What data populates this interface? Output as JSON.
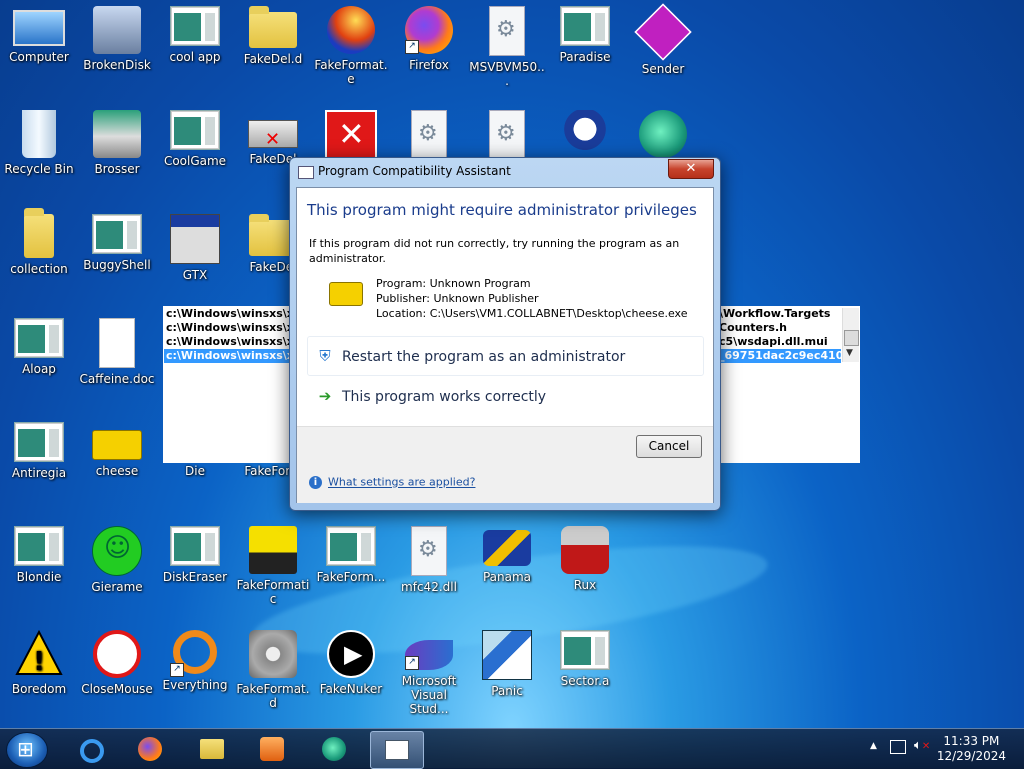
{
  "desktop": {
    "icons": [
      {
        "label": "Computer",
        "icon": "computer-icon"
      },
      {
        "label": "BrokenDisk",
        "icon": "brokendisk-icon"
      },
      {
        "label": "cool app",
        "icon": "window-icon"
      },
      {
        "label": "FakeDel.d",
        "icon": "folder-icon"
      },
      {
        "label": "FakeFormat.e",
        "icon": "torch-icon"
      },
      {
        "label": "Firefox",
        "icon": "firefox-icon"
      },
      {
        "label": "MSVBVM50...",
        "icon": "gear-doc-icon"
      },
      {
        "label": "Paradise",
        "icon": "window-icon"
      },
      {
        "label": "Sender",
        "icon": "sender-icon"
      },
      {
        "label": "Recycle Bin",
        "icon": "recycle-bin-icon"
      },
      {
        "label": "Brosser",
        "icon": "brosser-icon"
      },
      {
        "label": "CoolGame",
        "icon": "window-icon"
      },
      {
        "label": "FakeDel",
        "icon": "fakedel-icon"
      },
      {
        "label": "collection",
        "icon": "folder-icon"
      },
      {
        "label": "BuggyShell",
        "icon": "window-icon"
      },
      {
        "label": "GTX",
        "icon": "gtx-icon"
      },
      {
        "label": "FakeDel",
        "icon": "folder-icon"
      },
      {
        "label": "Aloap",
        "icon": "window-icon"
      },
      {
        "label": "Caffeine.doc",
        "icon": "document-icon"
      },
      {
        "label": "Antiregia",
        "icon": "window-icon"
      },
      {
        "label": "cheese",
        "icon": "cheese-icon"
      },
      {
        "label": "Die",
        "icon": "window-icon"
      },
      {
        "label": "FakeForm",
        "icon": "window-icon"
      },
      {
        "label": "Blondie",
        "icon": "window-icon"
      },
      {
        "label": "Gierame",
        "icon": "smiley-icon"
      },
      {
        "label": "DiskEraser",
        "icon": "window-icon"
      },
      {
        "label": "FakeFormatic",
        "icon": "fakeformatic-icon"
      },
      {
        "label": "FakeForm...",
        "icon": "window-icon"
      },
      {
        "label": "mfc42.dll",
        "icon": "gear-doc-icon"
      },
      {
        "label": "Panama",
        "icon": "handshake-icon"
      },
      {
        "label": "Rux",
        "icon": "rux-icon"
      },
      {
        "label": "Boredom",
        "icon": "warning-icon"
      },
      {
        "label": "CloseMouse",
        "icon": "no-arp-icon"
      },
      {
        "label": "Everything",
        "icon": "everything-icon"
      },
      {
        "label": "FakeFormat.d",
        "icon": "disk-icon"
      },
      {
        "label": "FakeNuker",
        "icon": "play-icon"
      },
      {
        "label": "Microsoft Visual Stud...",
        "icon": "visual-studio-icon"
      },
      {
        "label": "Panic",
        "icon": "panic-icon"
      },
      {
        "label": "Sector.a",
        "icon": "window-icon"
      }
    ]
  },
  "background_list": {
    "left_rows": [
      "c:\\Windows\\winsxs\\x8",
      "c:\\Windows\\winsxs\\x8",
      "c:\\Windows\\winsxs\\x8",
      "c:\\Windows\\winsxs\\x8"
    ],
    "right_rows": [
      "\\Workflow.Targets",
      "Counters.h",
      "c5\\wsdapi.dll.mui",
      "_69751dac2c9ec410\\Xa"
    ]
  },
  "dialog": {
    "title": "Program Compatibility Assistant",
    "close_label": "✕",
    "heading": "This program might require administrator privileges",
    "description": "If this program did not run correctly, try running the program as an administrator.",
    "program": "Program: Unknown Program",
    "publisher": "Publisher: Unknown Publisher",
    "location": "Location: C:\\Users\\VM1.COLLABNET\\Desktop\\cheese.exe",
    "option_restart": "Restart the program as an administrator",
    "option_works": "This program works correctly",
    "cancel_label": "Cancel",
    "help_link": "What settings are applied?"
  },
  "taskbar": {
    "pinned": [
      "internet-explorer-icon",
      "firefox-icon",
      "file-explorer-icon",
      "media-player-icon",
      "app-icon",
      "active-window-icon"
    ],
    "time": "11:33 PM",
    "date": "12/29/2024"
  },
  "colors": {
    "heading": "#1a3c8c",
    "selection": "#3399ff",
    "close_button": "#c7432c"
  }
}
